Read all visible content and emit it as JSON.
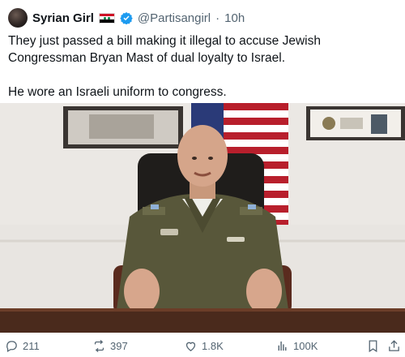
{
  "tweet": {
    "display_name": "Syrian Girl",
    "handle": "@Partisangirl",
    "separator": "·",
    "time": "10h",
    "text_line1": "They just passed a bill making it illegal to accuse Jewish Congressman Bryan Mast of dual loyalty to Israel.",
    "text_line2": "He wore an Israeli uniform to congress."
  },
  "actions": {
    "replies": "211",
    "reposts": "397",
    "likes": "1.8K",
    "views": "100K"
  },
  "colors": {
    "verified": "#1d9bf0",
    "muted_text": "#536471",
    "uniform": "#5a5a3a"
  },
  "icons": [
    "reply-icon",
    "repost-icon",
    "like-icon",
    "views-icon",
    "bookmark-icon",
    "share-icon",
    "verified-icon"
  ]
}
